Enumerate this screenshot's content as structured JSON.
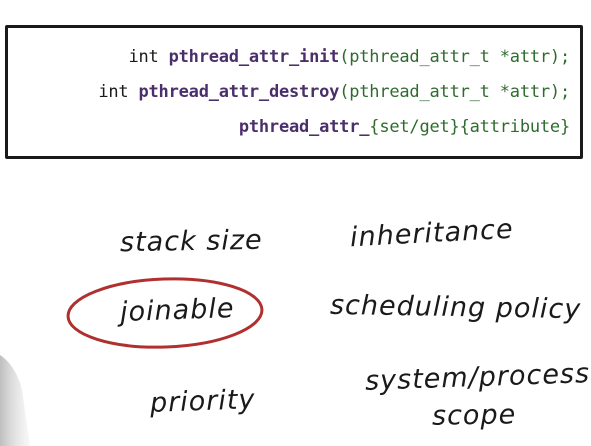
{
  "code": {
    "line1": {
      "prefix": "int ",
      "fn": "pthread_attr_init",
      "args": "(pthread_attr_t *attr);",
      "fn_color": "#4b2f6b",
      "args_color": "#2f6b2f"
    },
    "line2": {
      "prefix": "int ",
      "fn": "pthread_attr_destroy",
      "args": "(pthread_attr_t *attr);"
    },
    "line3": {
      "fn": "pthread_attr_",
      "setget": "{set/get}",
      "attr": "{attribute}"
    }
  },
  "handwritten": {
    "stack_size": "stack size",
    "inheritance": "inheritance",
    "joinable": "joinable",
    "scheduling_policy": "scheduling policy",
    "priority": "priority",
    "system_process": "system/process",
    "scope": "scope"
  },
  "colors": {
    "ink": "#1a1a1a",
    "function_name": "#4b2f6b",
    "type_green": "#2f6b2f",
    "circle_red": "#b03030"
  }
}
